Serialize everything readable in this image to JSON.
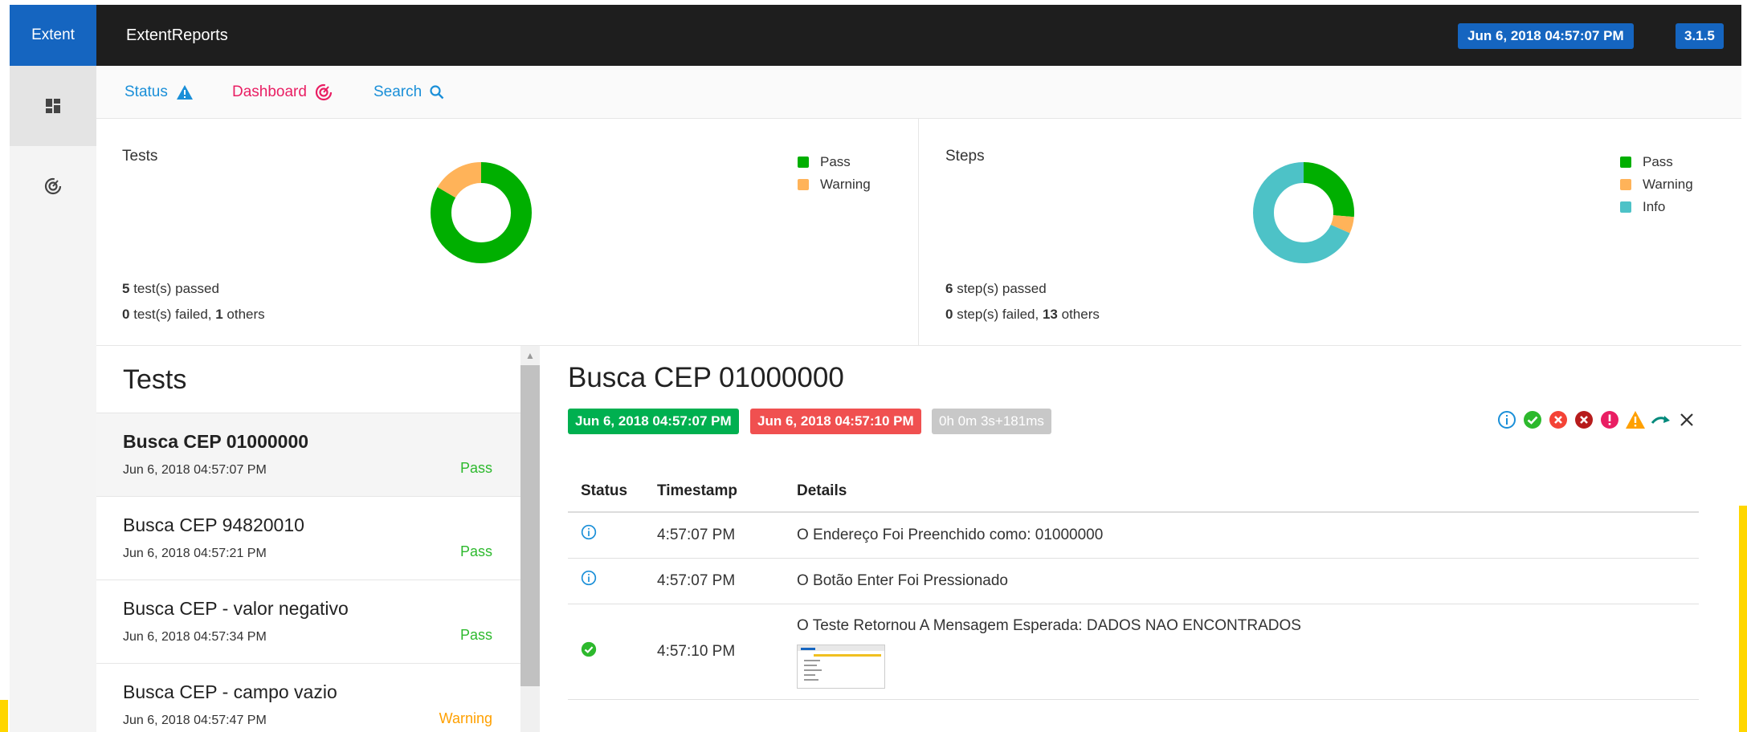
{
  "brand": "Extent",
  "app_title": "ExtentReports",
  "header": {
    "datetime": "Jun 6, 2018 04:57:07 PM",
    "version": "3.1.5"
  },
  "nav": {
    "status": "Status",
    "dashboard": "Dashboard",
    "search": "Search"
  },
  "tests_panel": {
    "title": "Tests",
    "passed_count": "5",
    "passed_text": " test(s) passed",
    "failed_count": "0",
    "failed_text": " test(s) failed, ",
    "others_count": "1",
    "others_text": " others",
    "legend": [
      "Pass",
      "Warning"
    ],
    "chart_data": {
      "type": "pie",
      "categories": [
        "Pass",
        "Warning"
      ],
      "values": [
        5,
        1
      ]
    }
  },
  "steps_panel": {
    "title": "Steps",
    "passed_count": "6",
    "passed_text": " step(s) passed",
    "failed_count": "0",
    "failed_text": " step(s) failed, ",
    "others_count": "13",
    "others_text": " others",
    "legend": [
      "Pass",
      "Warning",
      "Info"
    ],
    "chart_data": {
      "type": "pie",
      "categories": [
        "Pass",
        "Warning",
        "Info"
      ],
      "values": [
        5,
        1,
        13
      ]
    }
  },
  "colors": {
    "pass": "#00af00",
    "warning": "#ffb359",
    "info": "#4dc2c7",
    "brand": "#1565c0"
  },
  "test_list": {
    "title": "Tests",
    "items": [
      {
        "name": "Busca CEP 01000000",
        "date": "Jun 6, 2018 04:57:07 PM",
        "status": "Pass"
      },
      {
        "name": "Busca CEP 94820010",
        "date": "Jun 6, 2018 04:57:21 PM",
        "status": "Pass"
      },
      {
        "name": "Busca CEP - valor negativo",
        "date": "Jun 6, 2018 04:57:34 PM",
        "status": "Pass"
      },
      {
        "name": "Busca CEP - campo vazio",
        "date": "Jun 6, 2018 04:57:47 PM",
        "status": "Warning"
      }
    ]
  },
  "detail": {
    "title": "Busca CEP 01000000",
    "start": "Jun 6, 2018 04:57:07 PM",
    "end": "Jun 6, 2018 04:57:10 PM",
    "duration": "0h 0m 3s+181ms",
    "columns": [
      "Status",
      "Timestamp",
      "Details"
    ],
    "rows": [
      {
        "status_icon": "info-icon",
        "timestamp": "4:57:07 PM",
        "details": "O Endereço Foi Preenchido como: 01000000"
      },
      {
        "status_icon": "info-icon",
        "timestamp": "4:57:07 PM",
        "details": "O Botão Enter Foi Pressionado"
      },
      {
        "status_icon": "check-circle-icon",
        "timestamp": "4:57:10 PM",
        "details": "O Teste Retornou A Mensagem Esperada: DADOS NAO ENCONTRADOS"
      }
    ]
  }
}
